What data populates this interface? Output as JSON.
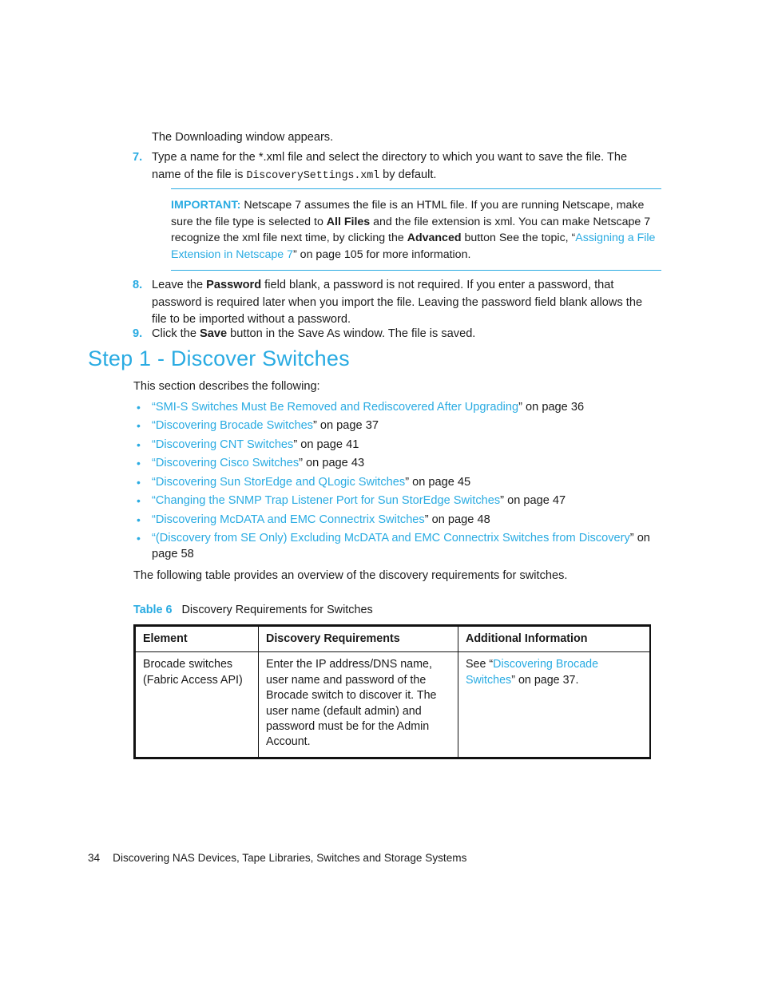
{
  "colors": {
    "accent": "#29ABE2",
    "text": "#1c1c1c",
    "rule": "#111111"
  },
  "intro": {
    "line": "The Downloading window appears."
  },
  "steps": [
    {
      "number": "7.",
      "text_before_mono": "Type a name for the *.xml file and select the directory to which you want to save the file. The name of the file is ",
      "mono": "DiscoverySettings.xml",
      "text_after_mono": " by default."
    },
    {
      "number": "8.",
      "part1": "Leave the ",
      "bold1": "Password",
      "part2": " field blank, a password is not required. If you enter a password, that password is required later when you import the file. Leaving the password field blank allows the file to be imported without a password."
    },
    {
      "number": "9.",
      "part1": "Click the ",
      "bold1": "Save",
      "part2": " button in the Save As window. The file is saved."
    }
  ],
  "note": {
    "label": "IMPORTANT:",
    "part1": "  Netscape 7 assumes the file is an HTML file. If you are running Netscape, make sure the file type is selected to ",
    "bold1": "All Files",
    "part2": " and the file extension is xml. You can make Netscape 7 recognize the xml file next time, by clicking the ",
    "bold2": "Advanced",
    "part3": " button See the topic, “",
    "link": "Assigning a File Extension in Netscape 7",
    "part4": "” on page 105 for more information."
  },
  "section": {
    "heading": "Step 1 - Discover Switches",
    "intro": "This section describes the following:"
  },
  "bullets": [
    {
      "open": "“",
      "link": "SMI-S Switches Must Be Removed and Rediscovered After Upgrading",
      "close": "” on page 36"
    },
    {
      "open": "“",
      "link": "Discovering Brocade Switches",
      "close": "” on page 37"
    },
    {
      "open": "“",
      "link": "Discovering CNT Switches",
      "close": "” on page 41"
    },
    {
      "open": "“",
      "link": "Discovering Cisco Switches",
      "close": "” on page 43"
    },
    {
      "open": "“",
      "link": "Discovering Sun StorEdge and QLogic Switches",
      "close": "” on page 45"
    },
    {
      "open": "“",
      "link": "Changing the SNMP Trap Listener Port for Sun StorEdge Switches",
      "close": "” on page 47"
    },
    {
      "open": "“",
      "link": "Discovering McDATA and EMC Connectrix Switches",
      "close": "” on page 48"
    },
    {
      "open": "“",
      "link": "(Discovery from SE Only) Excluding McDATA and EMC Connectrix Switches from Discovery",
      "close": "” on page 58"
    }
  ],
  "table_lead": "The following table provides an overview of the discovery requirements for switches.",
  "table": {
    "caption_number": "Table 6",
    "caption_text": "Discovery Requirements for Switches",
    "headers": [
      "Element",
      "Discovery Requirements",
      "Additional Information"
    ],
    "rows": [
      {
        "element": "Brocade switches (Fabric Access API)",
        "requirements": "Enter the IP address/DNS name, user name and password of the Brocade switch to discover it. The user name (default admin) and password must be for the Admin Account.",
        "additional_prefix": "See “",
        "additional_link": "Discovering Brocade Switches",
        "additional_suffix": "” on page 37."
      }
    ]
  },
  "footer": {
    "page_number": "34",
    "text": "Discovering NAS Devices, Tape Libraries, Switches and Storage Systems"
  }
}
